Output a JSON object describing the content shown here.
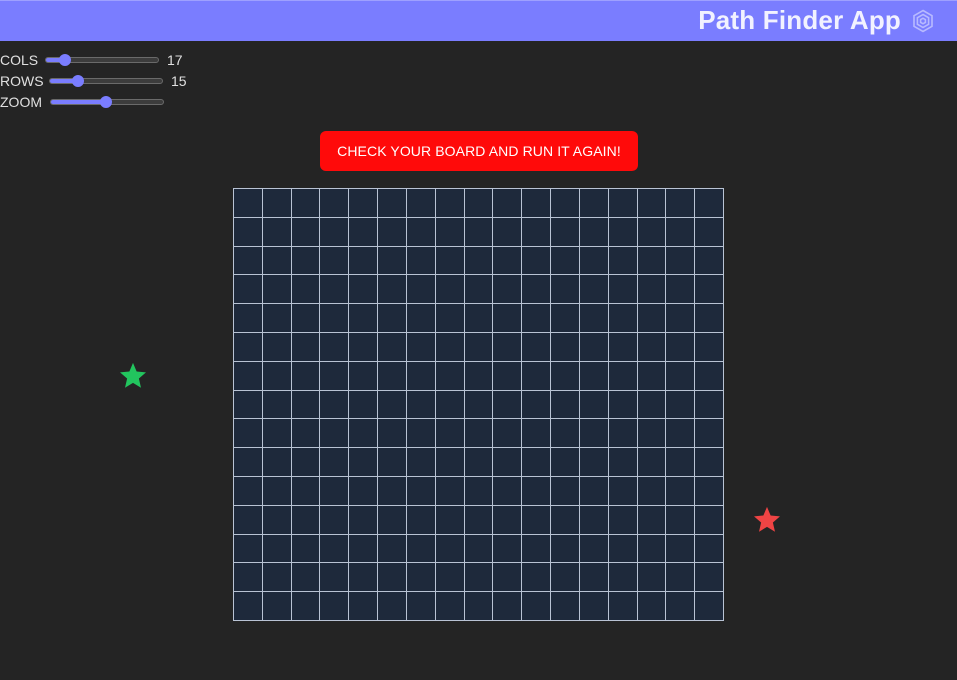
{
  "header": {
    "title": "Path Finder App",
    "logo_icon": "hexagon-rings-icon",
    "background": "#7a7dff"
  },
  "controls": {
    "cols": {
      "label": "COLS",
      "value": "17",
      "fraction": 0.17
    },
    "rows": {
      "label": "ROWS",
      "value": "15",
      "fraction": 0.25
    },
    "zoom": {
      "label": "ZOOM",
      "fraction": 0.49
    }
  },
  "run_button": {
    "label": "CHECK YOUR BOARD AND RUN IT AGAIN!",
    "color": "#ff0a0a"
  },
  "board": {
    "cols": 17,
    "rows": 15,
    "cell_color": "#1e293b",
    "line_color": "#b9c3d4"
  },
  "markers": {
    "start": {
      "icon": "start-star-icon",
      "color": "#22c55e"
    },
    "end": {
      "icon": "end-star-icon",
      "color": "#ef4444"
    }
  }
}
